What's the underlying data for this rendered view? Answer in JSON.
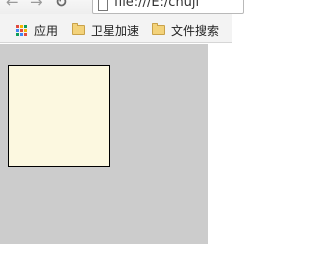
{
  "toolbar": {
    "back_icon": "back-arrow-icon",
    "forward_icon": "forward-arrow-icon",
    "reload_icon": "reload-icon",
    "url": "file:///E:/chuji"
  },
  "bookmarks": {
    "apps_label": "应用",
    "items": [
      {
        "label": "卫星加速",
        "icon": "folder-icon"
      },
      {
        "label": "文件搜索",
        "icon": "folder-icon"
      }
    ]
  },
  "colors": {
    "container": "#cccccc",
    "box_fill": "#fcf8e0",
    "box_border": "#000000"
  }
}
